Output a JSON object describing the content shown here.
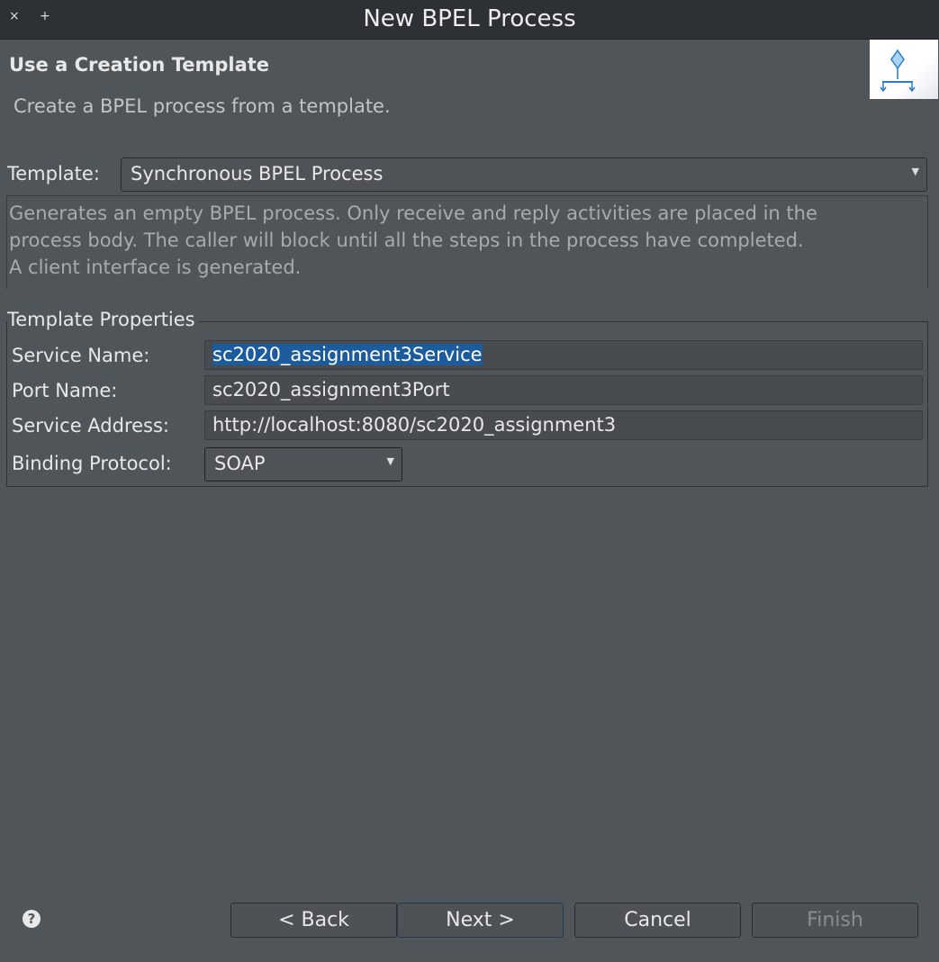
{
  "window": {
    "title": "New BPEL Process",
    "close_glyph": "×",
    "maximize_glyph": "+"
  },
  "header": {
    "title": "Use a Creation Template",
    "subtitle": "Create a BPEL process from a template.",
    "icon": "bpel-process-wizard-icon"
  },
  "template": {
    "label": "Template:",
    "selected": "Synchronous BPEL Process",
    "description_lines": [
      "Generates an empty BPEL process. Only receive and reply activities are placed in the",
      "process body. The caller will block until all the steps in the process have completed.",
      "A client interface is generated."
    ]
  },
  "properties": {
    "legend": "Template Properties",
    "service_name": {
      "label": "Service Name:",
      "value": "sc2020_assignment3Service"
    },
    "port_name": {
      "label": "Port Name:",
      "value": "sc2020_assignment3Port"
    },
    "service_address": {
      "label": "Service Address:",
      "value": "http://localhost:8080/sc2020_assignment3"
    },
    "binding_protocol": {
      "label": "Binding Protocol:",
      "value": "SOAP"
    }
  },
  "buttons": {
    "help": "?",
    "back": "< Back",
    "next": "Next >",
    "cancel": "Cancel",
    "finish": "Finish"
  },
  "colors": {
    "background": "#50555a",
    "titlebar": "#2d3135",
    "selection": "#1c5b9c",
    "disabled_text": "#8a8d90"
  }
}
